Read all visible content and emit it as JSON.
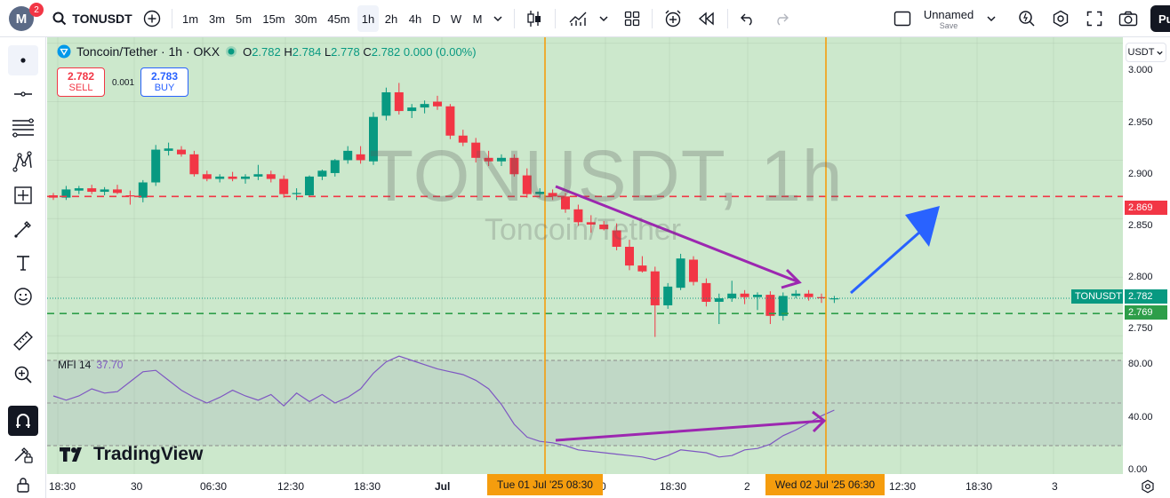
{
  "header": {
    "avatar_letter": "M",
    "notification_count": "2",
    "symbol": "TONUSDT",
    "intervals": [
      "1m",
      "3m",
      "5m",
      "15m",
      "30m",
      "45m",
      "1h",
      "2h",
      "4h",
      "D",
      "W",
      "M"
    ],
    "active_interval": "1h",
    "layout_name": "Unnamed",
    "save_label": "Save",
    "publish_label": "Pu"
  },
  "legend": {
    "title": "Toncoin/Tether · 1h · OKX",
    "o_label": "O",
    "o": "2.782",
    "h_label": "H",
    "h": "2.784",
    "l_label": "L",
    "l": "2.778",
    "c_label": "C",
    "c": "2.782",
    "change": "0.000 (0.00%)"
  },
  "trade": {
    "sell_price": "2.782",
    "sell_label": "SELL",
    "spread": "0.001",
    "buy_price": "2.783",
    "buy_label": "BUY"
  },
  "watermark": {
    "symbol": "TONUSDT, 1h",
    "name": "Toncoin/Tether"
  },
  "currency": "USDT",
  "indicator": {
    "name": "MFI 14",
    "value": "37.70"
  },
  "logo_text": "TradingView",
  "price_axis": {
    "ticks": [
      "3.000",
      "2.950",
      "2.900",
      "2.850",
      "2.800",
      "2.750"
    ],
    "tag_resistance": "2.869",
    "tag_last_label": "TONUSDT",
    "tag_last": "2.782",
    "tag_support": "2.769"
  },
  "mfi_axis": {
    "ticks": [
      "80.00",
      "40.00",
      "0.00"
    ]
  },
  "time_axis": {
    "labels": [
      "18:30",
      "30",
      "06:30",
      "12:30",
      "18:30",
      "Jul",
      "0",
      "18:30",
      "2",
      "12:30",
      "18:30",
      "3"
    ],
    "marker_1": "Tue 01 Jul '25   08:30",
    "marker_2": "Wed 02 Jul '25   06:30"
  },
  "colors": {
    "chart_bg": "#cce8cc",
    "up": "#089981",
    "down": "#f23645",
    "resistance": "#f23645",
    "support": "#2e9e4a",
    "marker": "#f59d0e",
    "divergence": "#9c27b0",
    "arrow": "#2962ff",
    "mfi_line": "#7e57c2"
  },
  "chart_data": {
    "type": "candlestick",
    "price_ylim": [
      2.735,
      3.005
    ],
    "mfi_ylim": [
      0,
      85
    ],
    "resistance_level": 2.869,
    "support_level": 2.769,
    "last_price": 2.782,
    "candles": [
      [
        2.87,
        2.872,
        2.866,
        2.868
      ],
      [
        2.868,
        2.878,
        2.866,
        2.875
      ],
      [
        2.874,
        2.878,
        2.871,
        2.876
      ],
      [
        2.876,
        2.879,
        2.871,
        2.873
      ],
      [
        2.873,
        2.877,
        2.87,
        2.875
      ],
      [
        2.875,
        2.879,
        2.871,
        2.872
      ],
      [
        2.87,
        2.874,
        2.862,
        2.869
      ],
      [
        2.868,
        2.883,
        2.864,
        2.881
      ],
      [
        2.881,
        2.913,
        2.878,
        2.909
      ],
      [
        2.908,
        2.915,
        2.904,
        2.91
      ],
      [
        2.909,
        2.912,
        2.903,
        2.905
      ],
      [
        2.905,
        2.908,
        2.886,
        2.888
      ],
      [
        2.888,
        2.891,
        2.882,
        2.884
      ],
      [
        2.884,
        2.888,
        2.881,
        2.886
      ],
      [
        2.886,
        2.89,
        2.882,
        2.884
      ],
      [
        2.884,
        2.888,
        2.88,
        2.886
      ],
      [
        2.886,
        2.896,
        2.883,
        2.888
      ],
      [
        2.888,
        2.891,
        2.881,
        2.884
      ],
      [
        2.884,
        2.887,
        2.868,
        2.871
      ],
      [
        2.871,
        2.876,
        2.866,
        2.872
      ],
      [
        2.87,
        2.887,
        2.869,
        2.886
      ],
      [
        2.886,
        2.892,
        2.883,
        2.891
      ],
      [
        2.889,
        2.901,
        2.886,
        2.9
      ],
      [
        2.9,
        2.912,
        2.897,
        2.908
      ],
      [
        2.905,
        2.912,
        2.897,
        2.9
      ],
      [
        2.899,
        2.941,
        2.896,
        2.937
      ],
      [
        2.938,
        2.962,
        2.934,
        2.958
      ],
      [
        2.958,
        2.966,
        2.939,
        2.942
      ],
      [
        2.942,
        2.948,
        2.936,
        2.945
      ],
      [
        2.945,
        2.951,
        2.94,
        2.948
      ],
      [
        2.95,
        2.955,
        2.943,
        2.946
      ],
      [
        2.946,
        2.948,
        2.918,
        2.921
      ],
      [
        2.921,
        2.926,
        2.912,
        2.915
      ],
      [
        2.915,
        2.919,
        2.898,
        2.902
      ],
      [
        2.902,
        2.908,
        2.895,
        2.899
      ],
      [
        2.899,
        2.905,
        2.895,
        2.902
      ],
      [
        2.902,
        2.905,
        2.886,
        2.888
      ],
      [
        2.887,
        2.893,
        2.868,
        2.871
      ],
      [
        2.871,
        2.876,
        2.868,
        2.873
      ],
      [
        2.872,
        2.875,
        2.866,
        2.869
      ],
      [
        2.869,
        2.872,
        2.855,
        2.858
      ],
      [
        2.858,
        2.862,
        2.844,
        2.847
      ],
      [
        2.847,
        2.853,
        2.838,
        2.845
      ],
      [
        2.845,
        2.848,
        2.84,
        2.841
      ],
      [
        2.84,
        2.846,
        2.823,
        2.826
      ],
      [
        2.826,
        2.832,
        2.806,
        2.81
      ],
      [
        2.81,
        2.818,
        2.804,
        2.805
      ],
      [
        2.805,
        2.809,
        2.749,
        2.776
      ],
      [
        2.776,
        2.795,
        2.773,
        2.792
      ],
      [
        2.791,
        2.82,
        2.789,
        2.816
      ],
      [
        2.815,
        2.818,
        2.793,
        2.796
      ],
      [
        2.795,
        2.799,
        2.775,
        2.779
      ],
      [
        2.779,
        2.786,
        2.76,
        2.782
      ],
      [
        2.782,
        2.797,
        2.779,
        2.786
      ],
      [
        2.786,
        2.789,
        2.777,
        2.783
      ],
      [
        2.783,
        2.787,
        2.772,
        2.785
      ],
      [
        2.785,
        2.788,
        2.76,
        2.767
      ],
      [
        2.767,
        2.787,
        2.763,
        2.784
      ],
      [
        2.784,
        2.789,
        2.782,
        2.786
      ],
      [
        2.786,
        2.789,
        2.78,
        2.783
      ],
      [
        2.783,
        2.786,
        2.778,
        2.782
      ],
      [
        2.782,
        2.784,
        2.778,
        2.782
      ]
    ],
    "mfi": [
      55,
      52,
      55,
      60,
      57,
      58,
      65,
      72,
      73,
      66,
      59,
      54,
      50,
      54,
      59,
      55,
      52,
      56,
      48,
      57,
      51,
      56,
      50,
      54,
      60,
      71,
      79,
      83,
      80,
      77,
      74,
      72,
      70,
      66,
      60,
      49,
      35,
      26,
      23,
      22,
      20,
      17,
      16,
      15,
      14,
      13,
      12,
      10,
      13,
      17,
      16,
      15,
      12,
      13,
      17,
      18,
      21,
      27,
      31,
      36,
      41,
      45
    ]
  }
}
